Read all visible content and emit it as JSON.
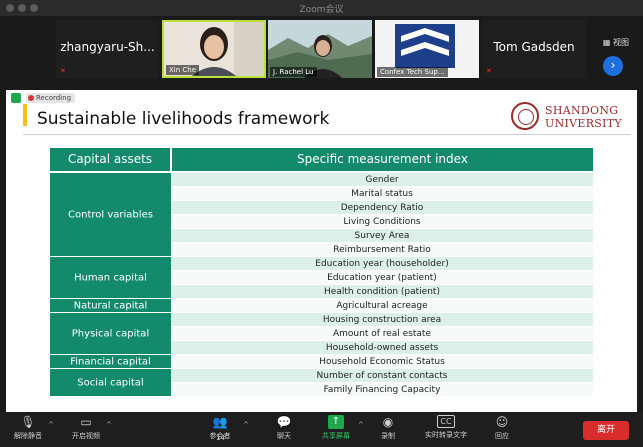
{
  "window": {
    "title": "Zoom会议"
  },
  "gallery": {
    "view_label": "视图",
    "participants": [
      {
        "name": "zhangyaru-Sh..."
      },
      {
        "name": "Xin Che"
      },
      {
        "name": "J. Rachel Lu"
      },
      {
        "name": "Confex Tech Sup..."
      },
      {
        "name": "Tom Gadsden"
      }
    ]
  },
  "recording": {
    "label": "Recording"
  },
  "slide": {
    "title": "Sustainable livelihoods framework",
    "logo_lines": [
      "SHANDONG",
      "UNIVERSITY"
    ],
    "table": {
      "headers": [
        "Capital assets",
        "Specific measurement index"
      ],
      "groups": [
        {
          "capital": "Control variables",
          "indices": [
            "Gender",
            "Marital status",
            "Dependency Ratio",
            "Living Conditions",
            "Survey Area",
            "Reimbursement Ratio"
          ]
        },
        {
          "capital": "Human capital",
          "indices": [
            "Education year (householder)",
            "Education year (patient)",
            "Health condition (patient)"
          ]
        },
        {
          "capital": "Natural capital",
          "indices": [
            "Agricultural acreage"
          ]
        },
        {
          "capital": "Physical capital",
          "indices": [
            "Housing construction area",
            "Amount of real estate",
            "Household-owned assets"
          ]
        },
        {
          "capital": "Financial capital",
          "indices": [
            "Household Economic Status"
          ]
        },
        {
          "capital": "Social capital",
          "indices": [
            "Number of constant contacts",
            "Family Financing Capacity"
          ]
        }
      ]
    }
  },
  "toolbar": {
    "unmute": "解除静音",
    "start_video": "开启视频",
    "participants": "参会者",
    "participant_count": "14",
    "chat": "聊天",
    "share_screen": "共享屏幕",
    "record": "录制",
    "live_transcript": "实时转录文字",
    "reactions": "回应",
    "leave": "离开"
  },
  "colors": {
    "table_green": "#128a6b",
    "row_light": "#dcefe8",
    "row_white": "#f6faf8",
    "leave_red": "#d92d2d",
    "share_green": "#1fa84e"
  }
}
